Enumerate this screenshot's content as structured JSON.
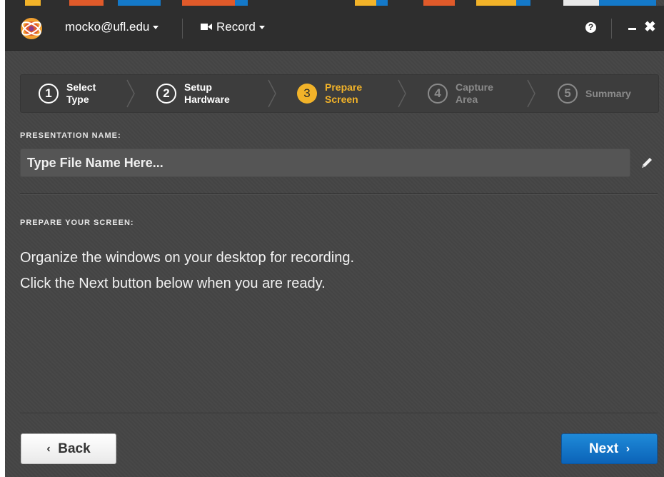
{
  "header": {
    "account_email": "mocko@ufl.edu",
    "record_label": "Record",
    "help_label": "?",
    "close_label": "✖"
  },
  "steps": [
    {
      "number": "1",
      "line1": "Select",
      "line2": "Type",
      "state": "done"
    },
    {
      "number": "2",
      "line1": "Setup",
      "line2": "Hardware",
      "state": "done"
    },
    {
      "number": "3",
      "line1": "Prepare",
      "line2": "Screen",
      "state": "active"
    },
    {
      "number": "4",
      "line1": "Capture",
      "line2": "Area",
      "state": "future"
    },
    {
      "number": "5",
      "line1": "Summary",
      "line2": "",
      "state": "future"
    }
  ],
  "presentation": {
    "label": "PRESENTATION NAME:",
    "value": "",
    "placeholder": "Type File Name Here..."
  },
  "prepare": {
    "label": "PREPARE YOUR SCREEN:",
    "line1": "Organize the windows on your desktop for recording.",
    "line2": "Click the Next button below when you are ready."
  },
  "footer": {
    "back_label": "Back",
    "next_label": "Next"
  },
  "colors": {
    "accent": "#f2b329",
    "primary_button": "#1479c9",
    "background": "#454545",
    "titlebar": "#2e2e2e"
  },
  "icons": [
    "app-logo-icon",
    "video-camera-icon",
    "help-icon",
    "minimize-icon",
    "close-icon",
    "pencil-icon",
    "chevron-left-icon",
    "chevron-right-icon"
  ]
}
